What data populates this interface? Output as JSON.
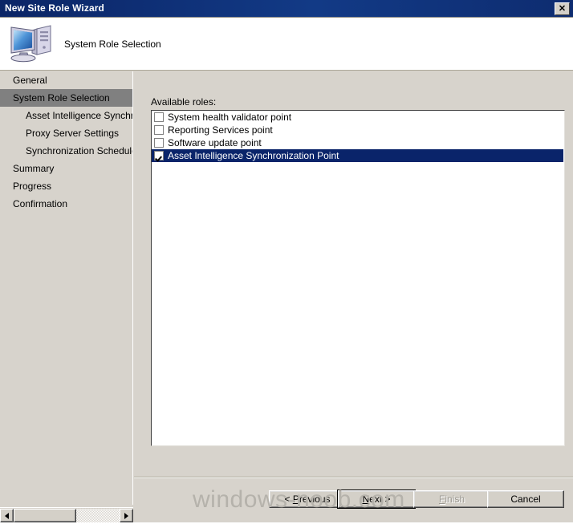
{
  "window": {
    "title": "New Site Role Wizard",
    "close_label": "✕"
  },
  "header": {
    "title": "System Role Selection",
    "icon": "computer-icon"
  },
  "sidebar": {
    "items": [
      {
        "label": "General",
        "level": 0,
        "selected": false
      },
      {
        "label": "System Role Selection",
        "level": 0,
        "selected": true
      },
      {
        "label": "Asset Intelligence Synchron",
        "level": 1,
        "selected": false
      },
      {
        "label": "Proxy Server Settings",
        "level": 1,
        "selected": false
      },
      {
        "label": "Synchronization Schedule",
        "level": 1,
        "selected": false
      },
      {
        "label": "Summary",
        "level": 0,
        "selected": false
      },
      {
        "label": "Progress",
        "level": 0,
        "selected": false
      },
      {
        "label": "Confirmation",
        "level": 0,
        "selected": false
      }
    ]
  },
  "main": {
    "roles_label": "Available roles:",
    "roles": [
      {
        "label": "System health validator point",
        "checked": false,
        "selected": false
      },
      {
        "label": "Reporting Services point",
        "checked": false,
        "selected": false
      },
      {
        "label": "Software update point",
        "checked": false,
        "selected": false
      },
      {
        "label": "Asset Intelligence Synchronization Point",
        "checked": true,
        "selected": true
      }
    ]
  },
  "buttons": {
    "previous": {
      "prefix": "< ",
      "accel": "P",
      "suffix": "revious",
      "disabled": false,
      "focused": false
    },
    "next": {
      "prefix": "",
      "accel": "N",
      "suffix": "ext >",
      "disabled": false,
      "focused": true
    },
    "finish": {
      "prefix": "",
      "accel": "F",
      "suffix": "inish",
      "disabled": true,
      "focused": false
    },
    "cancel": {
      "prefix": "",
      "accel": "C",
      "suffix": "ancel",
      "disabled": false,
      "focused": false
    }
  },
  "watermark": {
    "text": "windows-noob.com"
  },
  "colors": {
    "titlebar": "#0a246a",
    "face": "#d7d3cc",
    "selection": "#0a246a",
    "nav_selected": "#808080",
    "watermark": "#b5b2ab"
  }
}
